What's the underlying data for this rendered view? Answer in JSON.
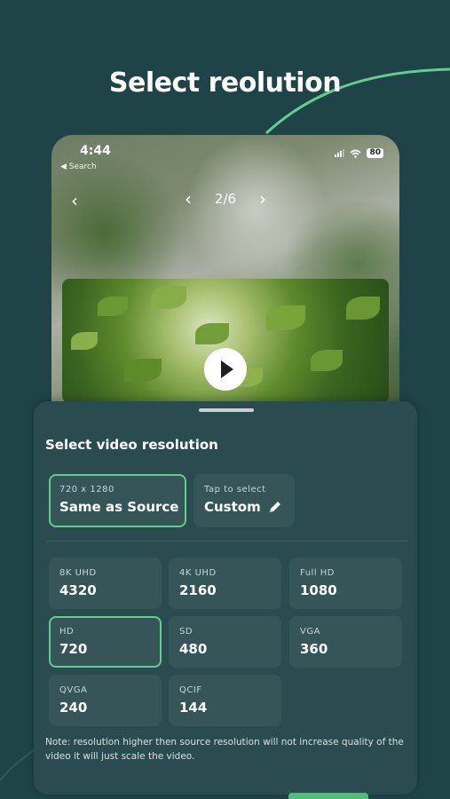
{
  "headline": "Select reolution",
  "colors": {
    "background": "#1f4448",
    "accent": "#5fcf8a",
    "sheet": "#2a4b50",
    "card": "#355559"
  },
  "phone": {
    "time": "4:44",
    "back_label": "◀ Search",
    "battery": "80",
    "nav_back_icon": "‹",
    "pager": {
      "prev_icon": "‹",
      "label": "2/6",
      "next_icon": "›"
    }
  },
  "sheet": {
    "title": "Select video resolution",
    "source_option": {
      "sub": "720 x 1280",
      "label": "Same as Source",
      "selected": true
    },
    "custom_option": {
      "sub": "Tap to select",
      "label": "Custom",
      "icon": "pencil-icon"
    },
    "resolutions": [
      {
        "name": "8K UHD",
        "value": "4320",
        "selected": false
      },
      {
        "name": "4K UHD",
        "value": "2160",
        "selected": false
      },
      {
        "name": "Full HD",
        "value": "1080",
        "selected": false
      },
      {
        "name": "HD",
        "value": "720",
        "selected": true
      },
      {
        "name": "SD",
        "value": "480",
        "selected": false
      },
      {
        "name": "VGA",
        "value": "360",
        "selected": false
      },
      {
        "name": "QVGA",
        "value": "240",
        "selected": false
      },
      {
        "name": "QCIF",
        "value": "144",
        "selected": false
      }
    ],
    "note": "Note: resolution higher then source resolution will not increase quality of the video it will just scale the video."
  }
}
